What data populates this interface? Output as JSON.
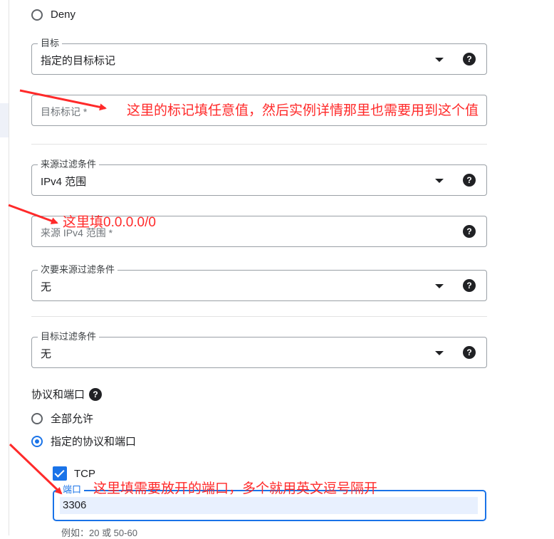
{
  "deny_option": {
    "label": "Deny"
  },
  "target": {
    "label": "目标",
    "value": "指定的目标标记"
  },
  "target_tags": {
    "placeholder": "目标标记 *"
  },
  "source_filter": {
    "label": "来源过滤条件",
    "value": "IPv4 范围"
  },
  "source_ipv4": {
    "placeholder": "来源 IPv4 范围 *"
  },
  "secondary_source_filter": {
    "label": "次要来源过滤条件",
    "value": "无"
  },
  "target_filter": {
    "label": "目标过滤条件",
    "value": "无"
  },
  "protocols": {
    "title": "协议和端口",
    "options": [
      "全部允许",
      "指定的协议和端口"
    ],
    "selected": "指定的协议和端口",
    "tcp": {
      "label": "TCP",
      "checked": true
    },
    "port_field": {
      "label": "端口",
      "value": "3306",
      "hint": "例如：20 或 50-60"
    }
  },
  "help_glyph": "?",
  "icons": [
    "chevron-down-icon",
    "help-icon",
    "checkbox-checked-icon"
  ],
  "colors": {
    "accent": "#1a73e8",
    "annotation": "#ff2a2a"
  },
  "annotations": {
    "tags_note": "这里的标记填任意值，然后实例详情那里也需要用到这个值",
    "ipv4_note": "这里填0.0.0.0/0",
    "port_note": "这里填需要放开的端口，多个就用英文逗号隔开"
  }
}
